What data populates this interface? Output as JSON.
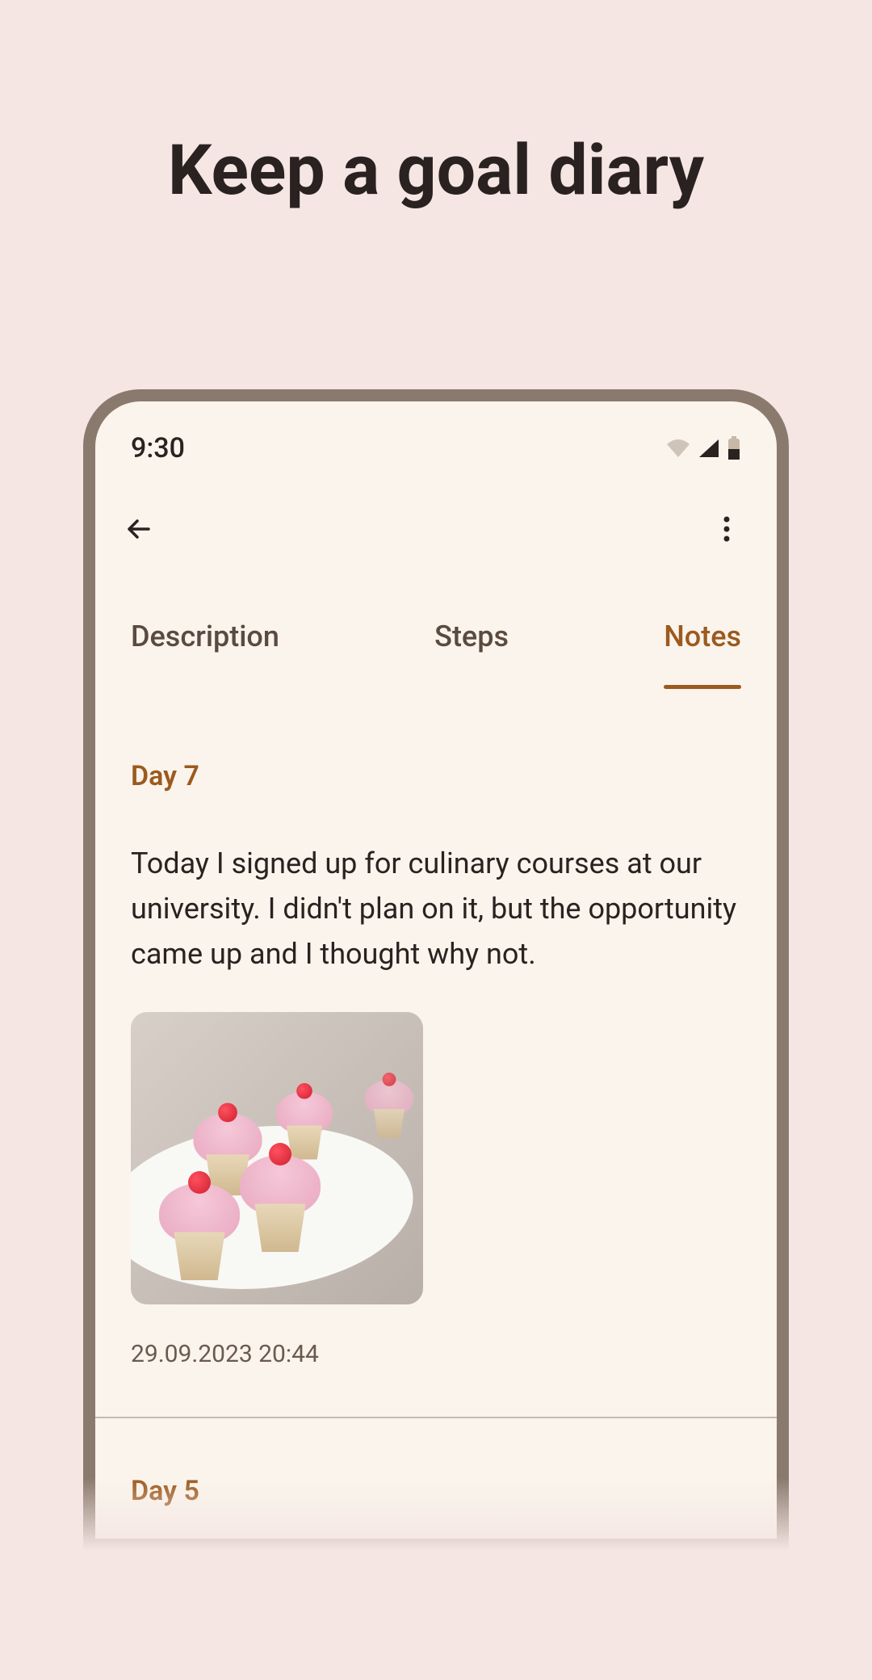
{
  "hero": {
    "title": "Keep a goal diary"
  },
  "statusBar": {
    "time": "9:30"
  },
  "tabs": {
    "description": "Description",
    "steps": "Steps",
    "notes": "Notes"
  },
  "notes": [
    {
      "dayTitle": "Day 7",
      "text": "Today I signed up for culinary courses at our university. I didn't plan on it, but the opportunity came up and I thought why not.",
      "timestamp": "29.09.2023 20:44"
    },
    {
      "dayTitle": "Day 5"
    }
  ]
}
